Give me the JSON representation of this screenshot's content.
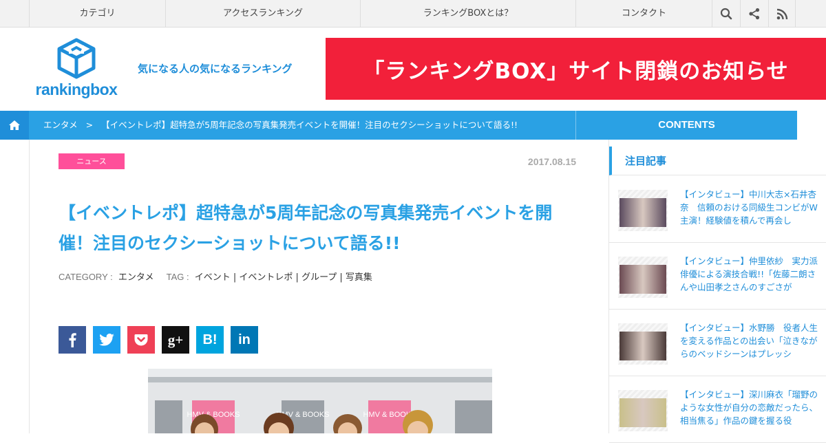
{
  "topnav": {
    "items": [
      "カテゴリ",
      "アクセスランキング",
      "ランキングBOXとは？",
      "コンタクト"
    ],
    "icons": [
      "search-icon",
      "share-icon",
      "rss-icon"
    ]
  },
  "header": {
    "logo_text": "rankingbox",
    "tagline": "気になる人の気になるランキング",
    "banner": "「ランキングBOX」サイト閉鎖のお知らせ"
  },
  "breadcrumb": {
    "category": "エンタメ",
    "separator": ">",
    "current": "【イベントレポ】超特急が5周年記念の写真集発売イベントを開催！注目のセクシーショットについて語る!!",
    "contents_tab": "CONTENTS"
  },
  "article": {
    "badge": "ニュース",
    "date": "2017.08.15",
    "title": "【イベントレポ】超特急が5周年記念の写真集発売イベントを開催！注目のセクシーショットについて語る!!",
    "category_label": "CATEGORY :",
    "category": "エンタメ",
    "tag_label": "TAG :",
    "tags": "イベント | イベントレポ | グループ | 写真集",
    "share_buttons": [
      {
        "label": "f",
        "color": "#3b5998"
      },
      {
        "label": "t",
        "color": "#1da1f2"
      },
      {
        "label": "p",
        "color": "#ef4056"
      },
      {
        "label": "g+",
        "color": "#111111"
      },
      {
        "label": "B!",
        "color": "#00a4de"
      },
      {
        "label": "in",
        "color": "#0077b5"
      }
    ],
    "photo_sign": "HMV & BOOKS"
  },
  "sidebar": {
    "heading": "注目記事",
    "items": [
      {
        "text": "【インタビュー】中川大志×石井杏奈　信頼のおける同級生コンビがW主演！経験値を積んで再会し",
        "color": "#5a4a5e"
      },
      {
        "text": "【インタビュー】仲里依紗　実力派俳優による演技合戦!!「佐藤二朗さんや山田孝之さんのすごさが",
        "color": "#6b4a52"
      },
      {
        "text": "【インタビュー】水野勝　役者人生を変える作品との出会い「泣きながらのベッドシーンはプレッシ",
        "color": "#4a3a38"
      },
      {
        "text": "【インタビュー】深川麻衣「瑠野のような女性が自分の恋敵だったら、相当焦る」作品の鍵を握る役",
        "color": "#c9c08a"
      }
    ]
  }
}
